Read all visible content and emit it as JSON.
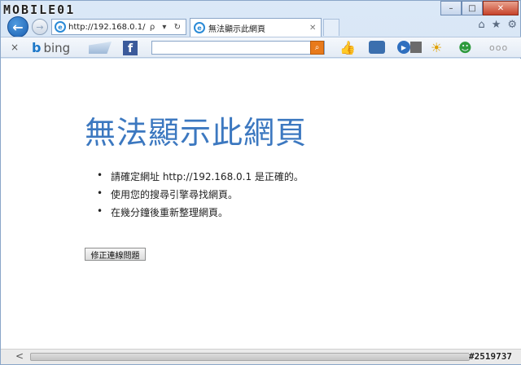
{
  "watermark": {
    "logo_text": "MOBILE01",
    "image_id": "#2519737"
  },
  "window": {
    "controls": [
      "–",
      "□",
      "✕"
    ]
  },
  "addressbar": {
    "url": "http://192.168.0.1/",
    "controls": "ρ ▾ ↻"
  },
  "tab": {
    "label": "無法顯示此網頁",
    "close": "✕"
  },
  "browser_icons": [
    "home-icon",
    "star-icon",
    "gear-icon"
  ],
  "toolbar": {
    "close": "×",
    "brand": "bing",
    "brand_mark": "b",
    "facebook_mark": "f",
    "more": "ooo",
    "icons": [
      "mail-icon",
      "facebook-icon",
      "search-icon",
      "like-icon",
      "chat-icon",
      "video-icon",
      "weather-icon",
      "messenger-icon"
    ],
    "search_button_color": "#e87a1b"
  },
  "error": {
    "title": "無法顯示此網頁",
    "title_color": "#3c78c0",
    "bullets": [
      "請確定網址 http://192.168.0.1 是正確的。",
      "使用您的搜尋引擎尋找網頁。",
      "在幾分鐘後重新整理網頁。"
    ],
    "fix_button": "修正連線問題"
  },
  "scrollbar": {
    "left_arrow": "<",
    "right_arrow": ">"
  }
}
